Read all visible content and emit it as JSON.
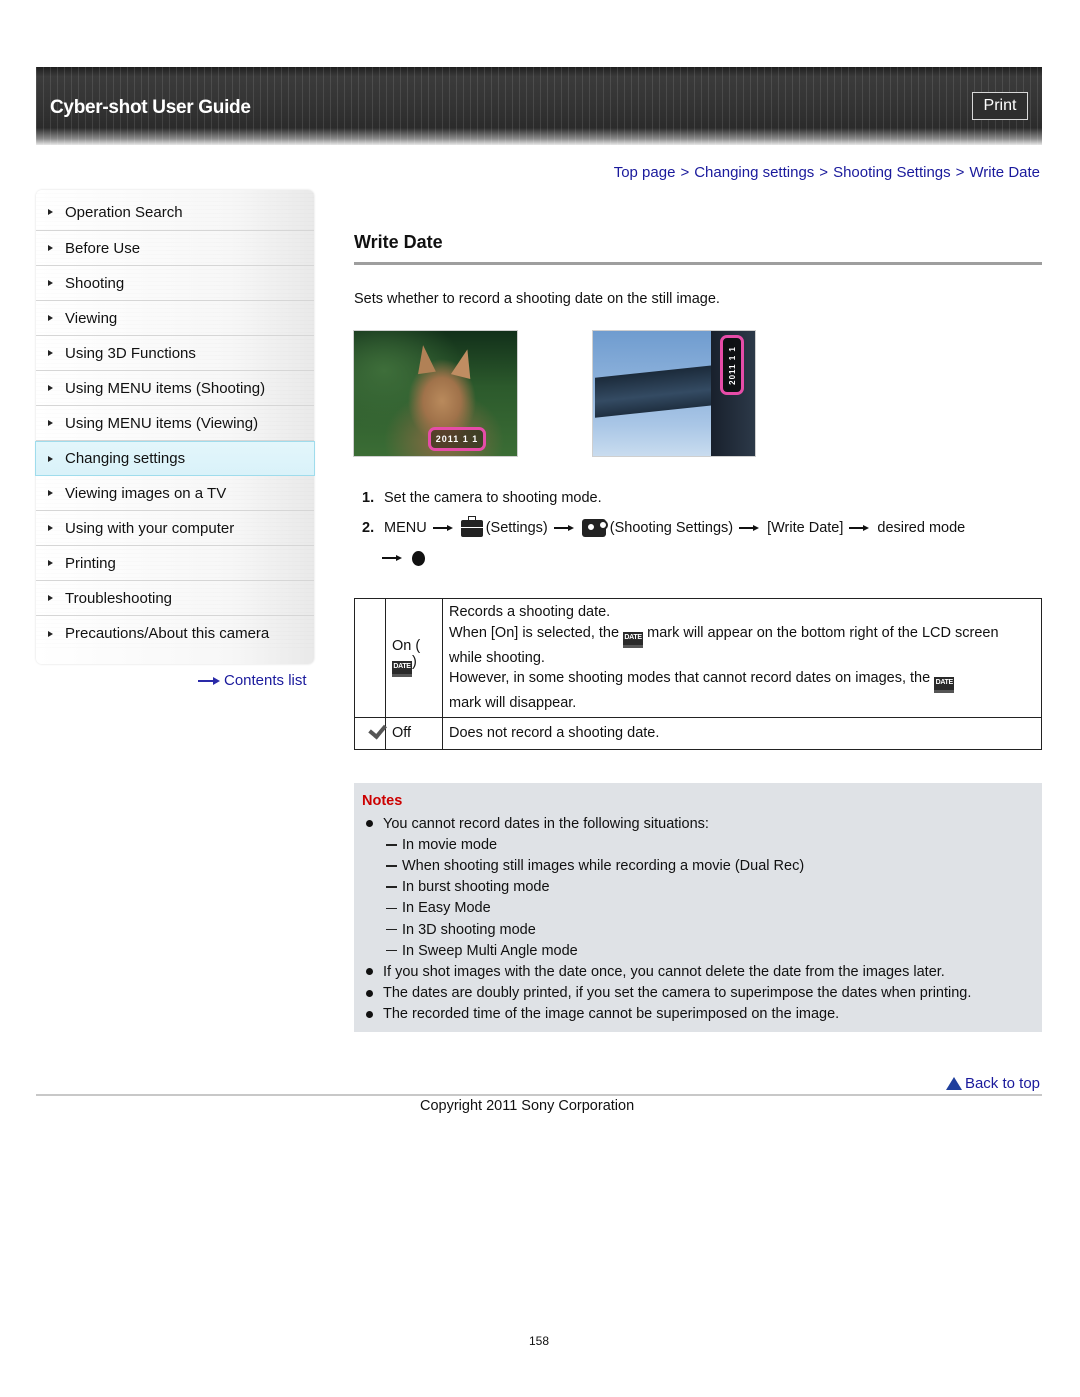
{
  "header": {
    "title": "Cyber-shot User Guide",
    "print_label": "Print"
  },
  "sidebar": {
    "items": [
      {
        "label": "Operation Search",
        "active": false
      },
      {
        "label": "Before Use",
        "active": false
      },
      {
        "label": "Shooting",
        "active": false
      },
      {
        "label": "Viewing",
        "active": false
      },
      {
        "label": "Using 3D Functions",
        "active": false
      },
      {
        "label": "Using MENU items (Shooting)",
        "active": false
      },
      {
        "label": "Using MENU items (Viewing)",
        "active": false
      },
      {
        "label": "Changing settings",
        "active": true
      },
      {
        "label": "Viewing images on a TV",
        "active": false
      },
      {
        "label": "Using with your computer",
        "active": false
      },
      {
        "label": "Printing",
        "active": false
      },
      {
        "label": "Troubleshooting",
        "active": false
      },
      {
        "label": "Precautions/About this camera",
        "active": false
      }
    ],
    "contents_link": "Contents list"
  },
  "breadcrumb": {
    "items": [
      "Top page",
      "Changing settings",
      "Shooting Settings",
      "Write Date"
    ],
    "separator": ">"
  },
  "main": {
    "title": "Write Date",
    "intro": "Sets whether to record a shooting date on the still image.",
    "images": [
      {
        "subject": "cat photo with date stamp",
        "stamp": "2011 1 1"
      },
      {
        "subject": "building photo with vertical date stamp",
        "stamp": "2011 1 1"
      }
    ],
    "steps": [
      {
        "num": "1.",
        "text": "Set the camera to shooting mode."
      },
      {
        "num": "2.",
        "menu": "MENU",
        "settings": "(Settings)",
        "shooting_settings": "(Shooting Settings)",
        "write_date": "[Write Date]",
        "desired": "desired mode"
      }
    ],
    "options": [
      {
        "icon": "",
        "label_prefix": "On (",
        "label_suffix": ")",
        "date_icon_text": "DATE",
        "desc": [
          "Records a shooting date.",
          "When [On] is selected, the",
          "mark will appear on the bottom right of the LCD screen while shooting.",
          "However, in some shooting modes that cannot record dates on images, the",
          "mark will disappear."
        ]
      },
      {
        "icon": "check-icon",
        "label": "Off",
        "desc": [
          "Does not record a shooting date."
        ],
        "default": true
      }
    ],
    "notes": {
      "title": "Notes",
      "items": [
        {
          "text": "You cannot record dates in the following situations:",
          "sub": [
            "In movie mode",
            "When shooting still images while recording a movie (Dual Rec)",
            "In burst shooting mode",
            "In Easy Mode",
            "In 3D shooting mode",
            "In Sweep Multi Angle mode"
          ]
        },
        {
          "text": "If you shot images with the date once, you cannot delete the date from the images later."
        },
        {
          "text": "The dates are doubly printed, if you set the camera to superimpose the dates when printing."
        },
        {
          "text": "The recorded time of the image cannot be superimposed on the image."
        }
      ]
    }
  },
  "footer": {
    "back_to_top": "Back to top",
    "copyright": "Copyright 2011 Sony Corporation",
    "page_number": "158"
  },
  "colors": {
    "link": "#1a1a9c",
    "notes_title": "#cc0000",
    "notes_bg": "#dfe2e6",
    "active_item_bg": "#dcf3fa",
    "date_stamp_ring": "#e64ca8"
  }
}
